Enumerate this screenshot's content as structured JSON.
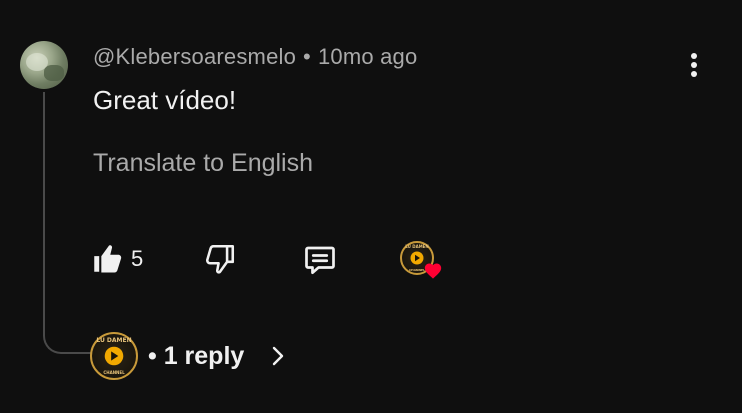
{
  "comment": {
    "author": "@Klebersoaresmelo",
    "separator": "•",
    "time": "10mo ago",
    "text": "Great vídeo!",
    "translate_label": "Translate to English",
    "like_count": "5"
  },
  "creator_badge": {
    "logo_top_text": "LU DAMEN",
    "logo_bottom_text": "CHANNEL"
  },
  "replies": {
    "label": "• 1 reply"
  },
  "icons": {
    "more": "more-vert-icon",
    "like": "thumbs-up-filled-icon",
    "dislike": "thumbs-down-icon",
    "reply": "reply-comment-icon",
    "creator_heart": "creator-heart-icon",
    "chevron": "chevron-right-icon"
  },
  "colors": {
    "background": "#0f0f0f",
    "primary_text": "#f1f1f1",
    "secondary_text": "#aaaaaa",
    "heart": "#ff0033",
    "logo_gold": "#c89a3a"
  }
}
